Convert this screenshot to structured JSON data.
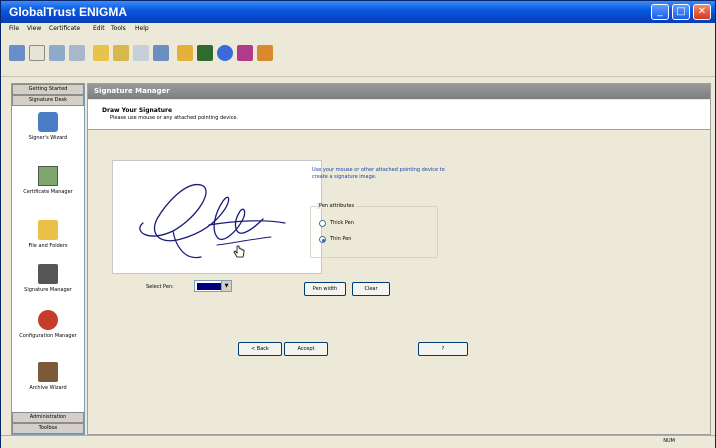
{
  "window": {
    "title": "GlobalTrust ENIGMA",
    "controls": {
      "minimize": "_",
      "maximize": "□",
      "close": "✕"
    }
  },
  "menu": [
    "File",
    "View",
    "Certificate",
    "Edit",
    "Tools",
    "Help"
  ],
  "toolbar_icons": [
    "wizard-icon",
    "document-icon",
    "folder-icon",
    "certificate-icon",
    "certificate-export-icon",
    "tree-icon",
    "keyboard-icon",
    "lock-icon",
    "user-icon",
    "globe-icon",
    "star-icon",
    "gear-icon",
    "settings-icon"
  ],
  "left_panel": {
    "top_headers": [
      "Getting Started",
      "Signature Desk"
    ],
    "items": [
      {
        "label": "Signer's Wizard",
        "icon": "signer-wizard-icon"
      },
      {
        "label": "Certificate Manager",
        "icon": "certificate-manager-icon"
      },
      {
        "label": "File and Folders",
        "icon": "file-folders-icon"
      },
      {
        "label": "Signature Manager",
        "icon": "signature-manager-icon"
      },
      {
        "label": "Configuration Manager",
        "icon": "configuration-manager-icon"
      },
      {
        "label": "Archive Wizard",
        "icon": "archive-wizard-icon"
      }
    ],
    "bottom_headers": [
      "Administration",
      "Toolbox"
    ]
  },
  "content": {
    "title": "Signature Manager",
    "header_title": "Draw Your Signature",
    "header_subtitle": "Please use mouse or any attached pointing device.",
    "hint": "Use your mouse or other attached pointing device to create a signature image.",
    "pen_group_label": "Pen attributes",
    "pen_options": [
      {
        "label": "Thick Pen",
        "selected": false
      },
      {
        "label": "Thin Pen",
        "selected": true
      }
    ],
    "pen_color_label": "Select Pen:",
    "pen_color": "#000080",
    "buttons": {
      "pen_width": "Pen width",
      "clear": "Clear",
      "back": "< Back",
      "accept": "Accept",
      "help": "?"
    }
  },
  "status": {
    "indicator": "NUM"
  }
}
